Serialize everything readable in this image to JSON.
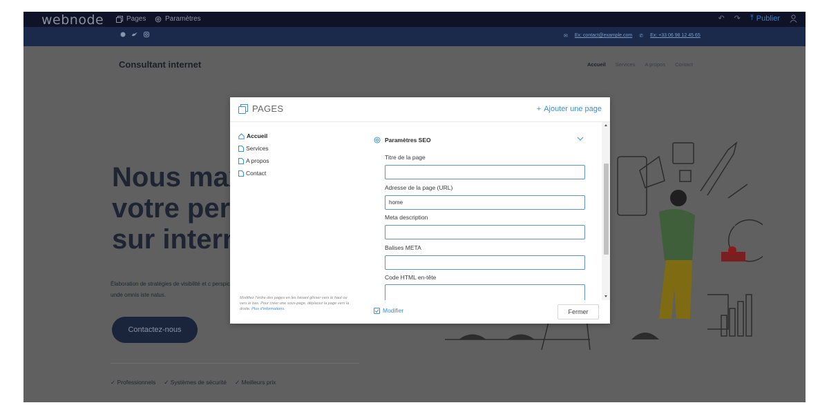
{
  "editor": {
    "logo": "webnode",
    "menu": [
      {
        "label": "Pages",
        "icon": "pages-icon"
      },
      {
        "label": "Paramètres",
        "icon": "settings-gear-icon"
      }
    ],
    "publish_label": "Publier"
  },
  "site": {
    "contact_email": "Ex: contact@example.com",
    "contact_phone": "Ex: +33 06 98 12 45 65",
    "brand": "Consultant internet",
    "nav": [
      "Accueil",
      "Services",
      "A propos",
      "Contact"
    ],
    "hero_lines": [
      "Nous max",
      "votre perf",
      "sur intern"
    ],
    "hero_text": "Élaboration de stratégies de visibilité et c perspiciatis unde omnis iste natus.",
    "cta_label": "Contactez-nous",
    "checks": [
      "Professionnels",
      "Systèmes de sécurité",
      "Meilleurs prix"
    ]
  },
  "modal": {
    "title": "PAGES",
    "add_page_label": "Ajouter une page",
    "pages": [
      "Accueil",
      "Services",
      "A propos",
      "Contact"
    ],
    "help_text": "Modifiez l'ordre des pages en les faisant glisser vers le haut ou vers le bas. Pour créer une sous-page, déplacez la page vers la droite.",
    "help_link": "Plus d'informations.",
    "section_title": "Paramètres SEO",
    "fields": {
      "title_label": "Titre de la page",
      "title_value": "",
      "url_label": "Adresse de la page (URL)",
      "url_value": "home",
      "meta_desc_label": "Meta description",
      "meta_desc_value": "",
      "meta_tags_label": "Balises META",
      "meta_tags_value": "",
      "html_head_label": "Code HTML en-tête",
      "html_head_value": ""
    },
    "modify_label": "Modifier",
    "close_label": "Fermer"
  },
  "colors": {
    "accent": "#3a8fd6",
    "editor_bar": "#0e1327",
    "site_header": "#1b2a4b",
    "overlay_bg": "#606060"
  }
}
